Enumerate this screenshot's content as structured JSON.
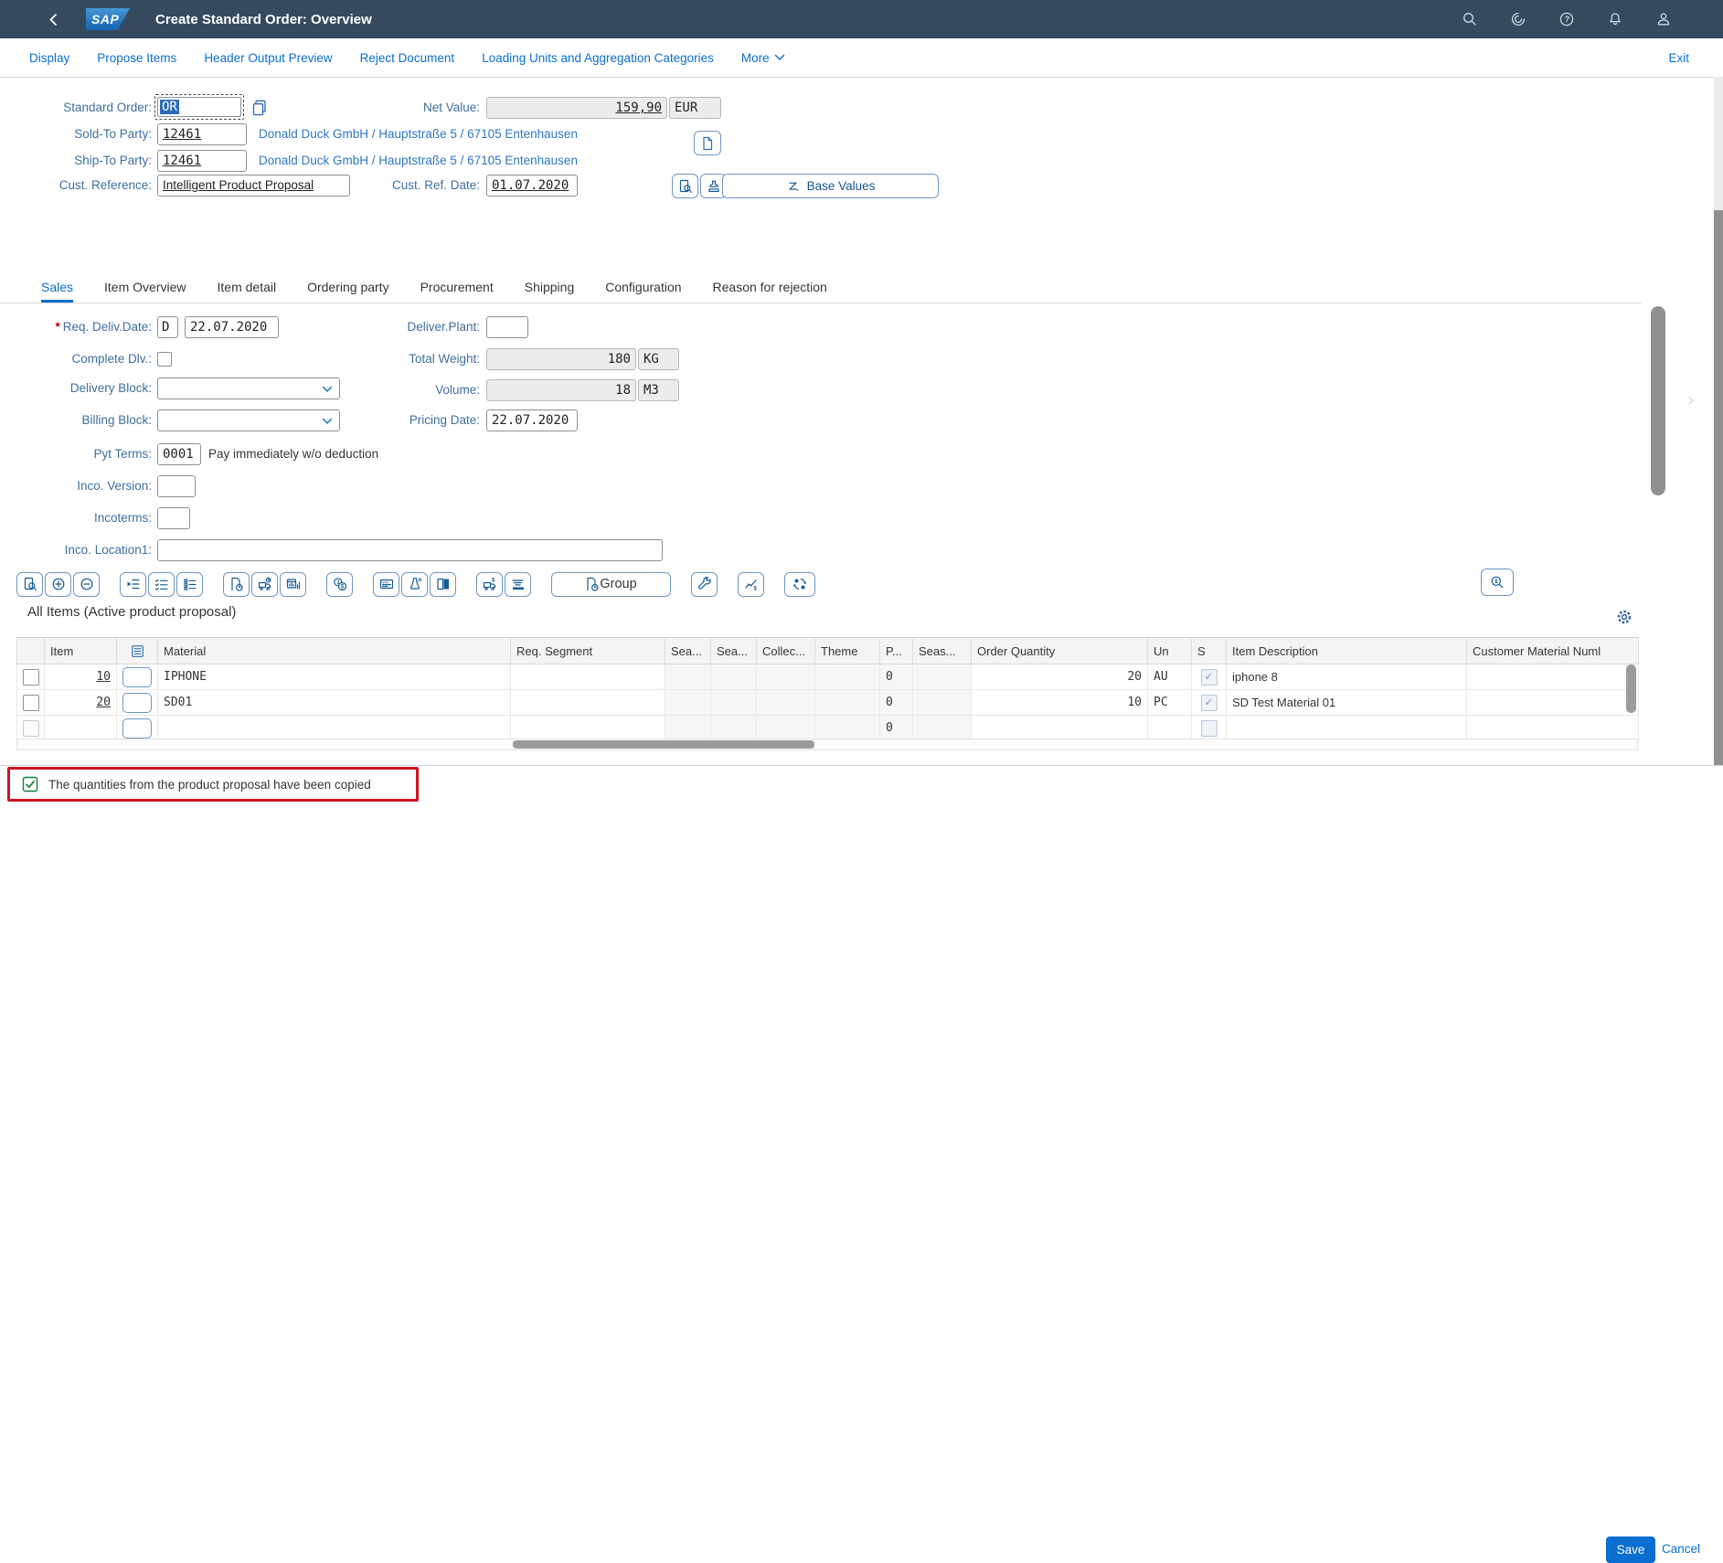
{
  "colors": {
    "shell_bg": "#354a5f",
    "accent_blue": "#0a6ed1",
    "toolbar_icon_blue": "#155a96",
    "label_blue": "#3f6f9e",
    "text": "#32363a",
    "success_green": "#107e3e",
    "annotation_red": "#cf1322",
    "readonly_bg": "#ececec"
  },
  "shell": {
    "title": "Create Standard Order: Overview",
    "logo_text": "SAP"
  },
  "menubar": {
    "items": [
      "Display",
      "Propose Items",
      "Header Output Preview",
      "Reject Document",
      "Loading Units and Aggregation Categories"
    ],
    "more_label": "More",
    "exit_label": "Exit"
  },
  "header_form": {
    "standard_order_label": "Standard Order:",
    "standard_order_value": "OR",
    "net_value_label": "Net Value:",
    "net_value": "159,90",
    "currency": "EUR",
    "sold_to_label": "Sold-To Party:",
    "sold_to_value": "12461",
    "sold_to_text": "Donald Duck GmbH / Hauptstraße 5 / 67105 Entenhausen",
    "ship_to_label": "Ship-To Party:",
    "ship_to_value": "12461",
    "ship_to_text": "Donald Duck GmbH / Hauptstraße 5 / 67105 Entenhausen",
    "cust_reference_label": "Cust. Reference:",
    "cust_reference_value": "Intelligent Product Proposal",
    "cust_ref_date_label": "Cust. Ref. Date:",
    "cust_ref_date_value": "01.07.2020",
    "base_values_label": "Base Values"
  },
  "tabs": {
    "items": [
      "Sales",
      "Item Overview",
      "Item detail",
      "Ordering party",
      "Procurement",
      "Shipping",
      "Configuration",
      "Reason for rejection"
    ],
    "active": "Sales"
  },
  "sales_form": {
    "req_deliv_date_label": "Req. Deliv.Date:",
    "req_deliv_date_type": "D",
    "req_deliv_date_value": "22.07.2020",
    "complete_dlv_label": "Complete Dlv.:",
    "delivery_block_label": "Delivery Block:",
    "billing_block_label": "Billing Block:",
    "pyt_terms_label": "Pyt Terms:",
    "pyt_terms_value": "0001",
    "pyt_terms_text": "Pay immediately w/o deduction",
    "inco_version_label": "Inco. Version:",
    "incoterms_label": "Incoterms:",
    "inco_location1_label": "Inco. Location1:",
    "deliver_plant_label": "Deliver.Plant:",
    "total_weight_label": "Total Weight:",
    "total_weight_value": "180",
    "total_weight_unit": "KG",
    "volume_label": "Volume:",
    "volume_value": "18",
    "volume_unit": "M3",
    "pricing_date_label": "Pricing Date:",
    "pricing_date_value": "22.07.2020"
  },
  "toolbar": {
    "group_label": "Group"
  },
  "items_section": {
    "title": "All Items (Active product proposal)",
    "columns": [
      "Item",
      "",
      "Material",
      "Req. Segment",
      "Sea...",
      "Sea...",
      "Collec...",
      "Theme",
      "P...",
      "Seas...",
      "Order Quantity",
      "Un",
      "S",
      "Item Description",
      "Customer Material Numl"
    ],
    "rows": [
      {
        "item": "10",
        "material": "IPHONE",
        "p": "0",
        "order_quantity": "20",
        "un": "AU",
        "s_checked": true,
        "description": "iphone 8"
      },
      {
        "item": "20",
        "material": "SD01",
        "p": "0",
        "order_quantity": "10",
        "un": "PC",
        "s_checked": true,
        "description": "SD Test Material 01"
      },
      {
        "item": "",
        "material": "",
        "p": "0",
        "order_quantity": "",
        "un": "",
        "s_checked": false,
        "description": ""
      }
    ]
  },
  "message_bar": {
    "text": "The quantities from the product proposal have been copied"
  },
  "footer": {
    "save_label": "Save",
    "cancel_label": "Cancel"
  },
  "icons": {
    "shell": [
      "back-icon",
      "search-icon",
      "copilot-icon",
      "help-icon",
      "notifications-icon",
      "profile-icon"
    ],
    "header": [
      "copy-icon",
      "document-icon",
      "document-search-icon",
      "stamp-icon",
      "sum-icon"
    ],
    "toolbar": [
      "details-icon",
      "add-row-icon",
      "remove-row-icon",
      "insert-row-icon",
      "select-items-icon",
      "item-list-icon",
      "propose-items-icon",
      "availability-check-icon",
      "schedule-lines-icon",
      "pricing-conditions-icon",
      "output-card-icon",
      "variant-config-icon",
      "document-flow-icon",
      "freight-costs-icon",
      "sort-stack-icon",
      "group-document-icon",
      "wrench-icon",
      "sales-summary-icon",
      "item-proposal-refresh-icon",
      "search-item-icon"
    ],
    "table": [
      "hierarchy-icon",
      "settings-gear-icon"
    ],
    "message": [
      "success-checkbox-icon"
    ]
  }
}
